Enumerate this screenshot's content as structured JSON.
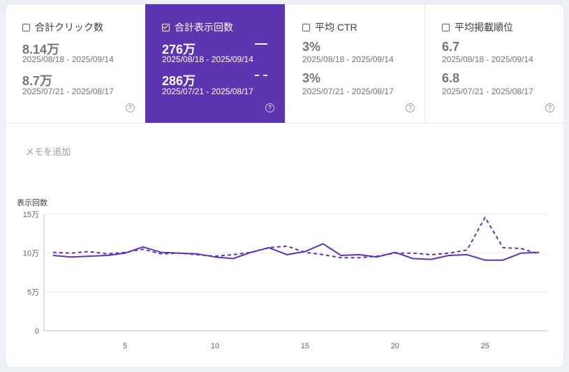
{
  "metrics": [
    {
      "label": "合計クリック数",
      "checked": false,
      "current_value": "8.14万",
      "current_range": "2025/08/18 - 2025/09/14",
      "previous_value": "8.7万",
      "previous_range": "2025/07/21 - 2025/08/17",
      "help": "?"
    },
    {
      "label": "合計表示回数",
      "checked": true,
      "current_value": "276万",
      "current_range": "2025/08/18 - 2025/09/14",
      "previous_value": "286万",
      "previous_range": "2025/07/21 - 2025/08/17",
      "help": "?"
    },
    {
      "label": "平均 CTR",
      "checked": false,
      "current_value": "3%",
      "current_range": "2025/08/18 - 2025/09/14",
      "previous_value": "3%",
      "previous_range": "2025/07/21 - 2025/08/17",
      "help": "?"
    },
    {
      "label": "平均掲載順位",
      "checked": false,
      "current_value": "6.7",
      "current_range": "2025/08/18 - 2025/09/14",
      "previous_value": "6.8",
      "previous_range": "2025/07/21 - 2025/08/17",
      "help": "?"
    }
  ],
  "memo_placeholder": "メモを追加",
  "colors": {
    "accent": "#5e35b1",
    "line": "#5e35b1",
    "grid": "#eeeeee"
  },
  "chart_data": {
    "type": "line",
    "ylabel": "表示回数",
    "xlabel": "",
    "ylim": [
      0,
      150000
    ],
    "yticks": [
      {
        "value": 0,
        "label": "0"
      },
      {
        "value": 50000,
        "label": "5万"
      },
      {
        "value": 100000,
        "label": "10万"
      },
      {
        "value": 150000,
        "label": "15万"
      }
    ],
    "xlim": [
      0.5,
      28.5
    ],
    "xticks": [
      {
        "value": 5,
        "label": "5"
      },
      {
        "value": 10,
        "label": "10"
      },
      {
        "value": 15,
        "label": "15"
      },
      {
        "value": 20,
        "label": "20"
      },
      {
        "value": 25,
        "label": "25"
      }
    ],
    "grid": true,
    "x": [
      1,
      2,
      3,
      4,
      5,
      6,
      7,
      8,
      9,
      10,
      11,
      12,
      13,
      14,
      15,
      16,
      17,
      18,
      19,
      20,
      21,
      22,
      23,
      24,
      25,
      26,
      27,
      28
    ],
    "series": [
      {
        "style": "solid",
        "range": "2025/08/18 - 2025/09/14",
        "values": [
          97000,
          95000,
          96000,
          97000,
          100000,
          108000,
          101000,
          100000,
          99000,
          95000,
          93000,
          101000,
          107000,
          98000,
          102000,
          112000,
          97000,
          98000,
          95000,
          101000,
          93000,
          92000,
          97000,
          98000,
          91000,
          91000,
          100000,
          101000
        ]
      },
      {
        "style": "dashed",
        "range": "2025/07/21 - 2025/08/17",
        "values": [
          101000,
          100000,
          102000,
          99000,
          101000,
          105000,
          99000,
          100000,
          98000,
          96000,
          98000,
          101000,
          107000,
          109000,
          101000,
          98000,
          94000,
          94000,
          96000,
          100000,
          100000,
          98000,
          100000,
          104000,
          146000,
          107000,
          106000,
          99000
        ]
      }
    ]
  }
}
